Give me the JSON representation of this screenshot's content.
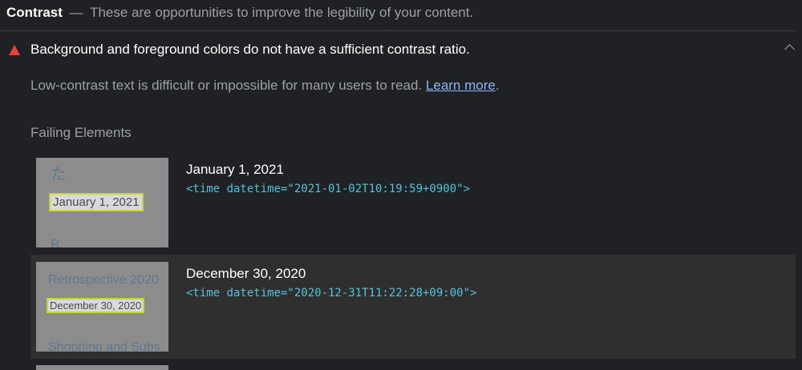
{
  "section": {
    "title": "Contrast",
    "separator": "—",
    "subtitle": "These are opportunities to improve the legibility of your content."
  },
  "audit": {
    "title": "Background and foreground colors do not have a sufficient contrast ratio.",
    "status_icon": "fail-triangle-icon",
    "status_color": "#ea4335",
    "expand_icon": "chevron-up-icon",
    "description": "Low-contrast text is difficult or impossible for many users to read.",
    "learn_more": "Learn more",
    "period": ".",
    "failing_label": "Failing Elements",
    "elements": [
      {
        "label": "January 1, 2021",
        "snippet": "<time datetime=\"2021-01-02T10:19:59+0900\">",
        "thumb_ghost_top": "た",
        "thumb_highlight": "January 1, 2021",
        "thumb_ghost_bottom": "R"
      },
      {
        "label": "December 30, 2020",
        "snippet": "<time datetime=\"2020-12-31T11:22:28+09:00\">",
        "thumb_ghost_top": "Retrospective 2020",
        "thumb_highlight": "December 30, 2020",
        "thumb_ghost_bottom": "Shopping and Subs"
      }
    ]
  }
}
